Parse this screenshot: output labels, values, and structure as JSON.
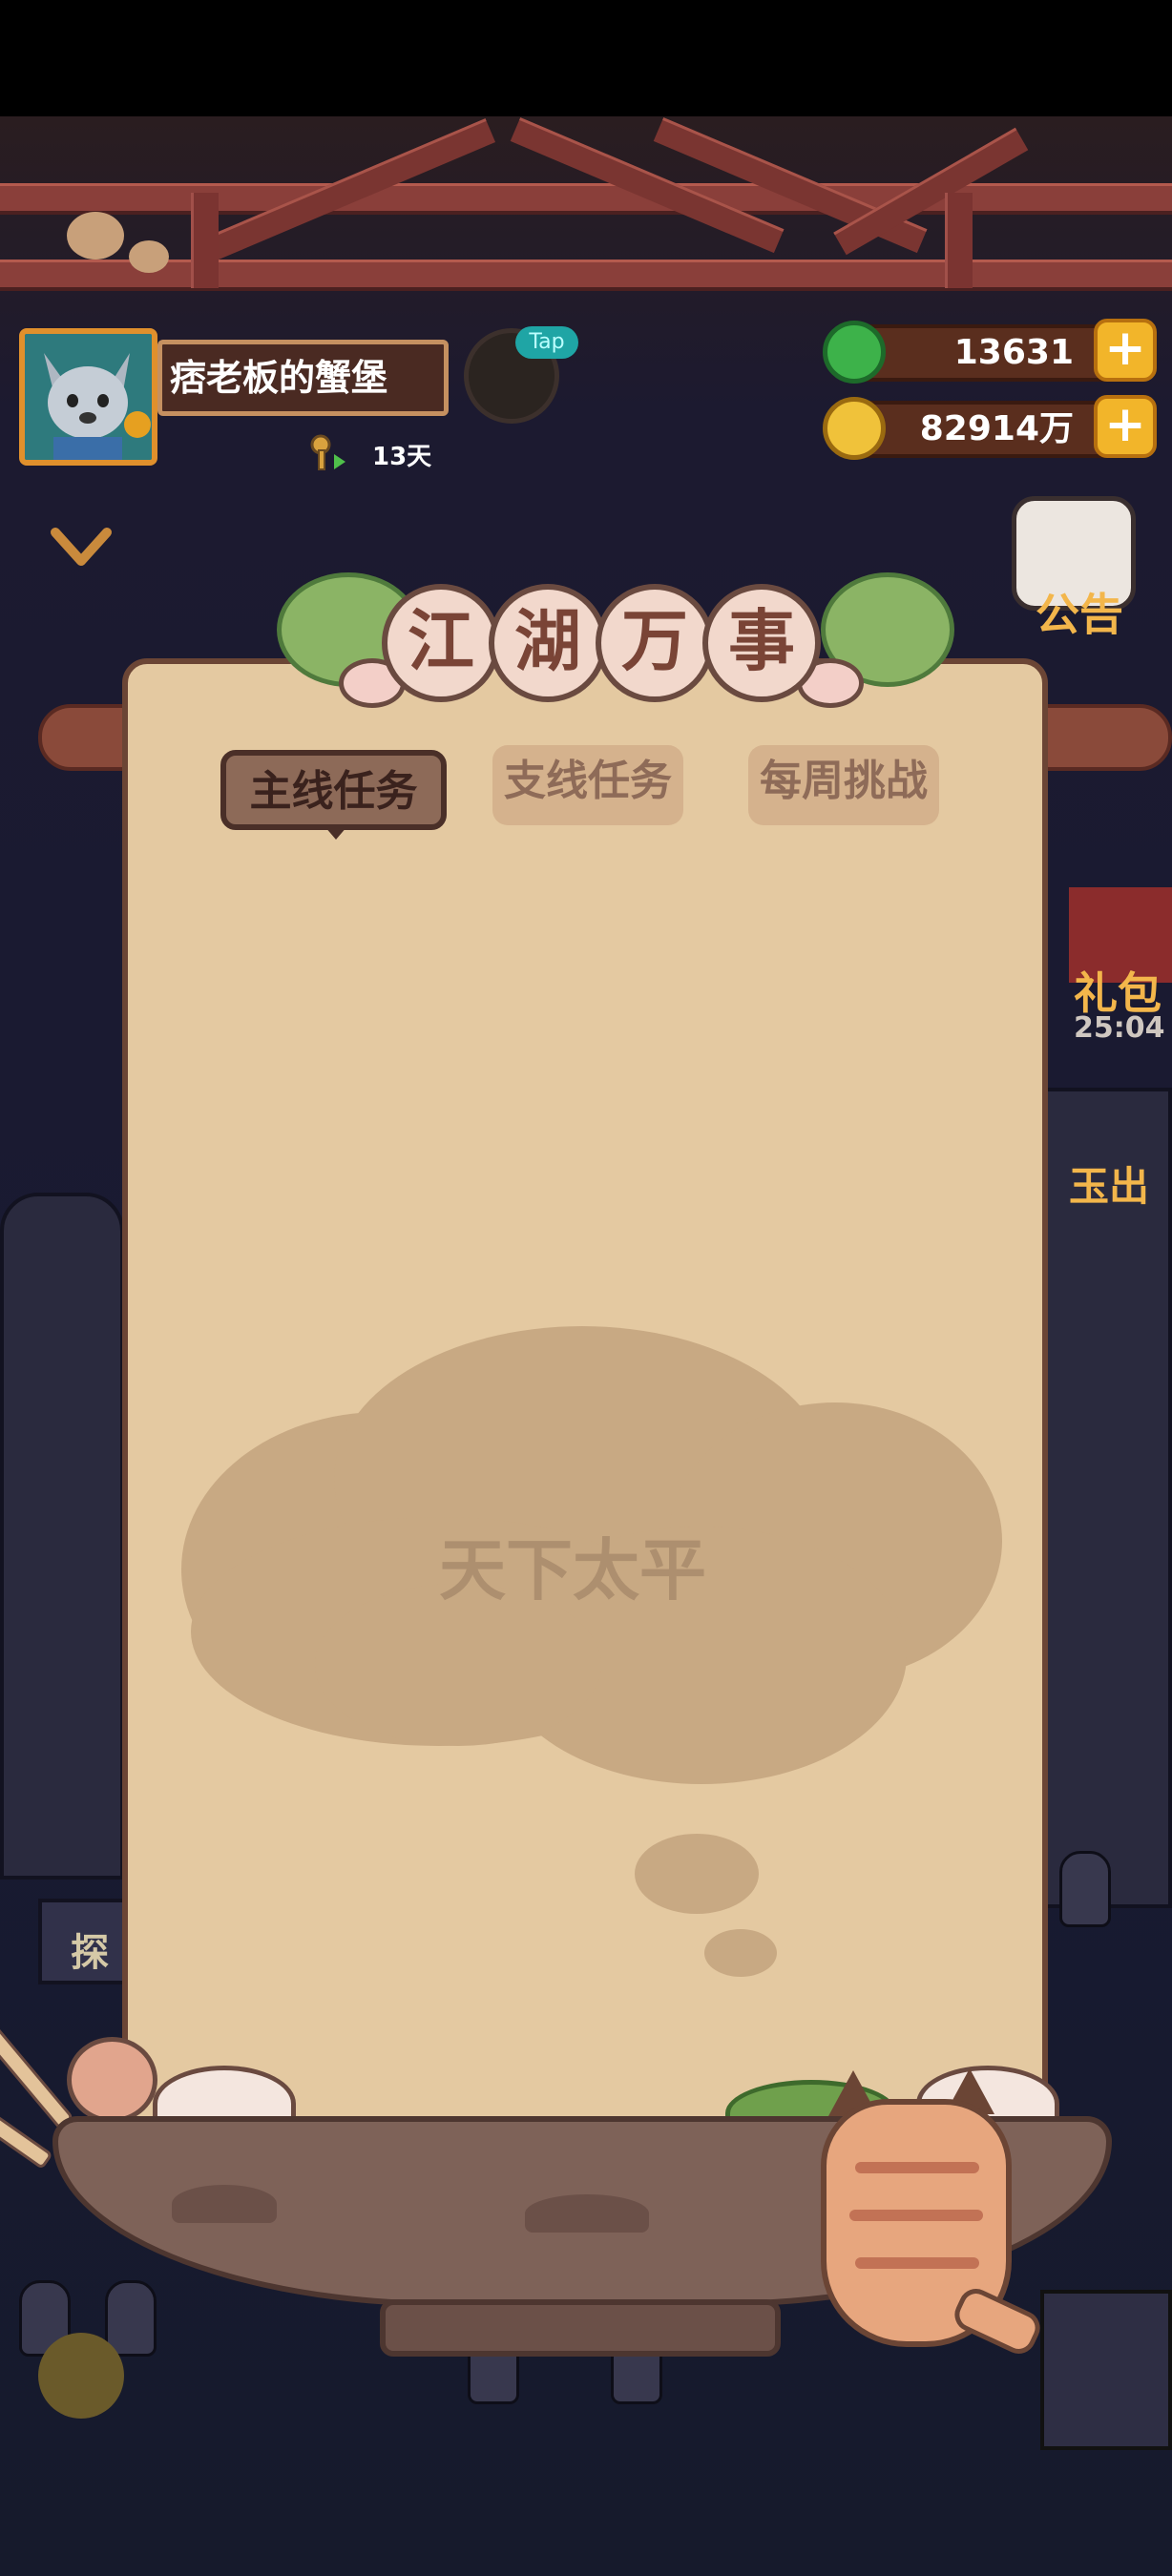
{
  "player": {
    "name": "痞老板的蟹堡",
    "days": "13天"
  },
  "currency": {
    "jade": "13631",
    "coins": "82914万"
  },
  "tap_tag": "Tap",
  "panel": {
    "title_chars": [
      "江",
      "湖",
      "万",
      "事"
    ],
    "tabs": {
      "main": "主线任务",
      "side": "支线任务",
      "weekly": "每周挑战"
    },
    "empty_message": "天下太平"
  },
  "side_menu": {
    "announcement": "公告",
    "gift": "礼包",
    "timer": "25:04",
    "item3": "玉出"
  },
  "colors": {
    "panel_bg": "#e4c9a1",
    "accent_gold": "#f2b52a",
    "brown_dark": "#4a2f28"
  }
}
